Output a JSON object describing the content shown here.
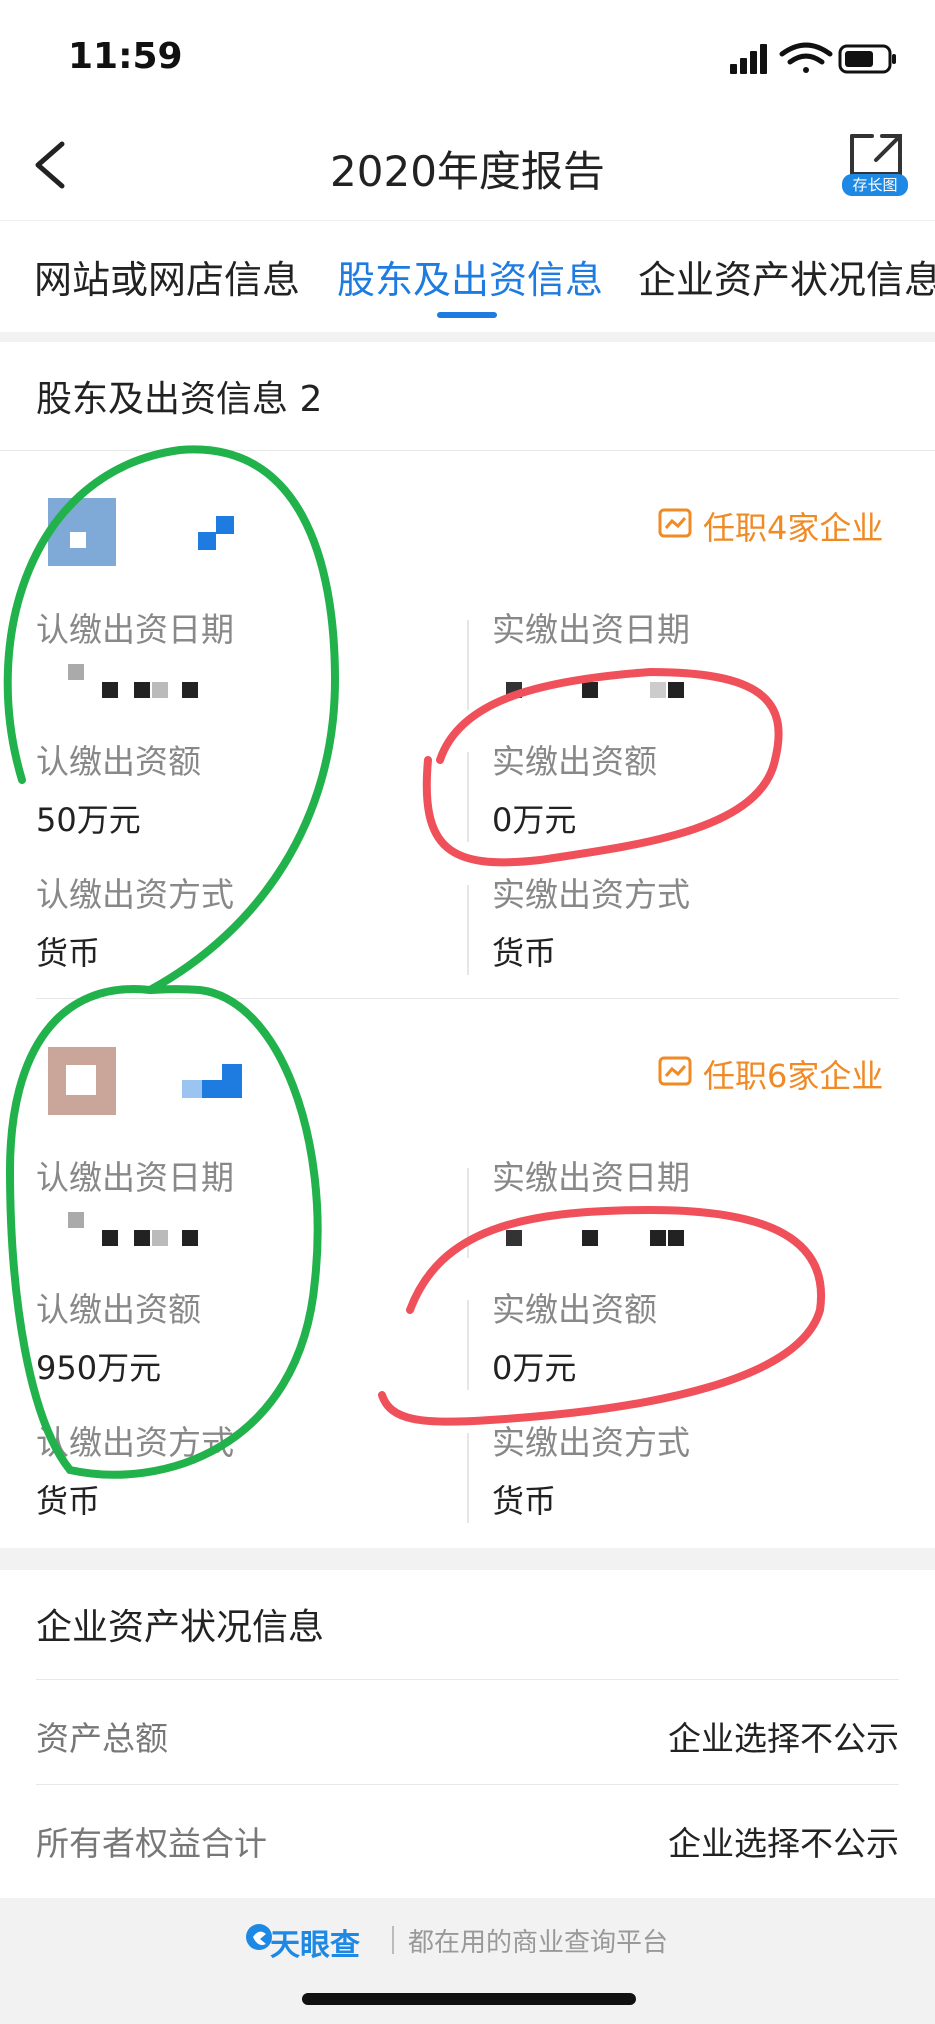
{
  "status_bar": {
    "time": "11:59"
  },
  "header": {
    "title": "2020年度报告",
    "long_image_label": "存长图"
  },
  "tabs": [
    {
      "label": "网站或网店信息"
    },
    {
      "label": "股东及出资信息"
    },
    {
      "label": "企业资产状况信息"
    }
  ],
  "shareholders_section": {
    "title": "股东及出资信息 2",
    "items": [
      {
        "tenure": "任职4家企业",
        "subscribed_date_label": "认缴出资日期",
        "paid_date_label": "实缴出资日期",
        "subscribed_amount_label": "认缴出资额",
        "subscribed_amount": "50万元",
        "paid_amount_label": "实缴出资额",
        "paid_amount": "0万元",
        "subscribed_method_label": "认缴出资方式",
        "subscribed_method": "货币",
        "paid_method_label": "实缴出资方式",
        "paid_method": "货币"
      },
      {
        "tenure": "任职6家企业",
        "subscribed_date_label": "认缴出资日期",
        "paid_date_label": "实缴出资日期",
        "subscribed_amount_label": "认缴出资额",
        "subscribed_amount": "950万元",
        "paid_amount_label": "实缴出资额",
        "paid_amount": "0万元",
        "subscribed_method_label": "认缴出资方式",
        "subscribed_method": "货币",
        "paid_method_label": "实缴出资方式",
        "paid_method": "货币"
      }
    ]
  },
  "assets_section": {
    "title": "企业资产状况信息",
    "rows": [
      {
        "label": "资产总额",
        "value": "企业选择不公示"
      },
      {
        "label": "所有者权益合计",
        "value": "企业选择不公示"
      }
    ]
  },
  "footer": {
    "brand": "天眼查",
    "slogan": "都在用的商业查询平台"
  },
  "colors": {
    "accent": "#1e7be0",
    "tenure": "#f08a24",
    "annotation_green": "#22b24c",
    "annotation_red": "#f0505a"
  }
}
